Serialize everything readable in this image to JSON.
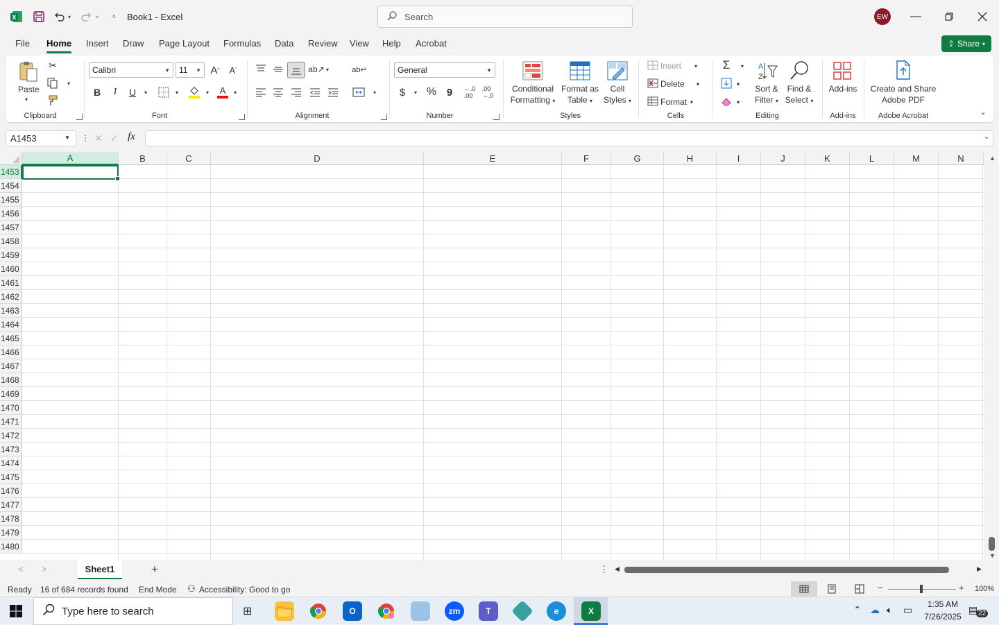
{
  "app": {
    "title": "Book1 - Excel",
    "search_placeholder": "Search",
    "avatar": "EW",
    "share_label": "Share"
  },
  "tabs": [
    "File",
    "Home",
    "Insert",
    "Draw",
    "Page Layout",
    "Formulas",
    "Data",
    "Review",
    "View",
    "Help",
    "Acrobat"
  ],
  "ribbon": {
    "clipboard": {
      "paste": "Paste",
      "label": "Clipboard"
    },
    "font": {
      "name": "Calibri",
      "size": "11",
      "label": "Font",
      "bold": "B",
      "italic": "I",
      "underline": "U"
    },
    "alignment": {
      "label": "Alignment"
    },
    "number": {
      "format": "General",
      "label": "Number",
      "currency": "$",
      "percent": "%",
      "comma": "9"
    },
    "styles": {
      "conditional": "Conditional",
      "conditional2": "Formatting",
      "format_table": "Format as",
      "format_table2": "Table",
      "cell_styles": "Cell",
      "cell_styles2": "Styles",
      "label": "Styles"
    },
    "cells": {
      "insert": "Insert",
      "delete": "Delete",
      "format": "Format",
      "label": "Cells"
    },
    "editing": {
      "sort": "Sort &",
      "sort2": "Filter",
      "find": "Find &",
      "find2": "Select",
      "label": "Editing"
    },
    "addins": {
      "addins": "Add-ins",
      "label": "Add-ins"
    },
    "acrobat": {
      "create": "Create and Share",
      "create2": "Adobe PDF",
      "label": "Adobe Acrobat"
    }
  },
  "formula_bar": {
    "name_box": "A1453",
    "fx": "fx",
    "value": ""
  },
  "columns": [
    "A",
    "B",
    "C",
    "D",
    "E",
    "F",
    "G",
    "H",
    "I",
    "J",
    "K",
    "L",
    "M",
    "N"
  ],
  "rows": [
    "1453",
    "1454",
    "1455",
    "1456",
    "1457",
    "1458",
    "1459",
    "1460",
    "1461",
    "1462",
    "1463",
    "1464",
    "1465",
    "1466",
    "1467",
    "1468",
    "1469",
    "1470",
    "1471",
    "1472",
    "1473",
    "1474",
    "1475",
    "1476",
    "1477",
    "1478",
    "1479",
    "1480"
  ],
  "sheet": {
    "name": "Sheet1",
    "add": "+"
  },
  "status": {
    "ready": "Ready",
    "records": "16 of 684 records found",
    "mode": "End Mode",
    "accessibility": "Accessibility: Good to go",
    "zoom": "100%"
  },
  "taskbar": {
    "search_placeholder": "Type here to search",
    "time": "1:35 AM",
    "date": "7/26/2025",
    "notifications": "22"
  }
}
